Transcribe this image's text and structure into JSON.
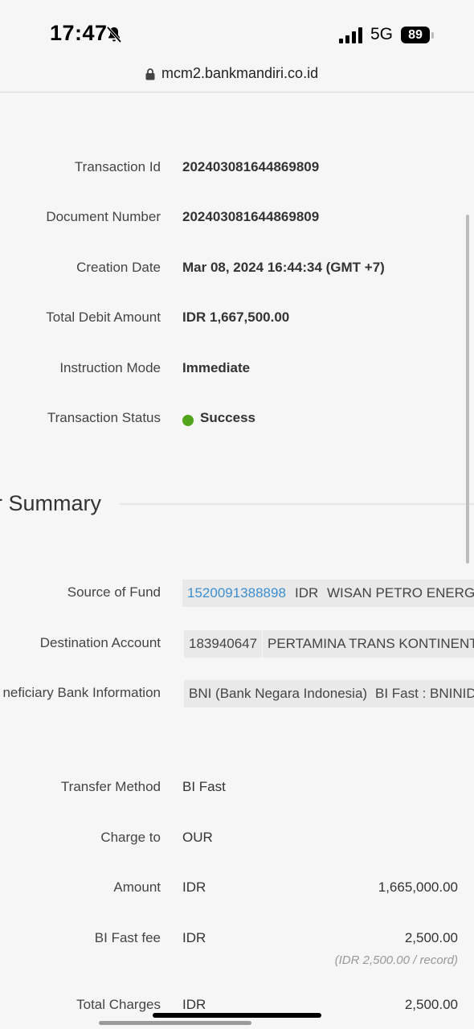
{
  "status_bar": {
    "time": "17:47",
    "network": "5G",
    "battery": "89"
  },
  "browser": {
    "url": "mcm2.bankmandiri.co.id"
  },
  "transaction": {
    "fields": [
      {
        "label": "Transaction Id",
        "value": "202403081644869809"
      },
      {
        "label": "Document Number",
        "value": "202403081644869809"
      },
      {
        "label": "Creation Date",
        "value": "Mar 08, 2024 16:44:34 (GMT +7)"
      },
      {
        "label": "Total Debit Amount",
        "value": "IDR 1,667,500.00"
      },
      {
        "label": "Instruction Mode",
        "value": "Immediate"
      },
      {
        "label": "Transaction Status",
        "value": "Success"
      }
    ],
    "status_color": "#52a41a"
  },
  "summary": {
    "title": "r Summary",
    "source_of_fund": {
      "label": "Source of Fund",
      "account": "1520091388898",
      "currency": "IDR",
      "name": "WISAN PETRO ENERGI"
    },
    "destination_account": {
      "label": "Destination Account",
      "account": "183940647",
      "name": "PERTAMINA TRANS KONTINENTAL"
    },
    "beneficiary_bank": {
      "label": "neficiary Bank Information",
      "bank": "BNI (Bank Negara Indonesia)",
      "code": "BI Fast : BNINIDJ"
    },
    "transfer_method": {
      "label": "Transfer Method",
      "value": "BI Fast"
    },
    "charge_to": {
      "label": "Charge to",
      "value": "OUR"
    },
    "amount": {
      "label": "Amount",
      "currency": "IDR",
      "value": "1,665,000.00"
    },
    "bi_fast_fee": {
      "label": "BI Fast fee",
      "currency": "IDR",
      "value": "2,500.00",
      "note": "(IDR 2,500.00 / record)"
    },
    "total_charges": {
      "label": "Total Charges",
      "currency": "IDR",
      "value": "2,500.00"
    }
  },
  "colors": {
    "link": "#3b8fd0",
    "background": "#f6f6f6",
    "chip": "#e9e9e9"
  }
}
